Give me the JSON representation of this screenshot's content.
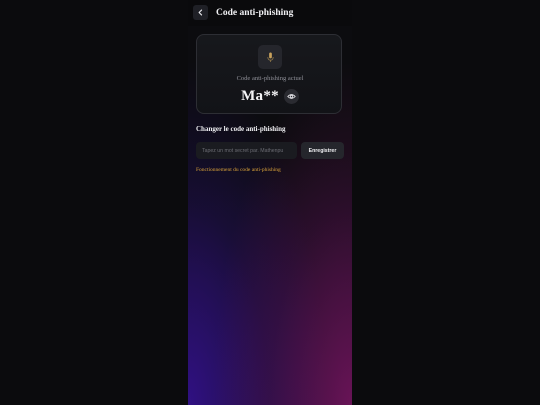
{
  "header": {
    "title": "Code anti-phishing",
    "back_icon": "chevron-left-icon"
  },
  "current_code": {
    "icon": "microphone-icon",
    "label": "Code anti-phishing actuel",
    "value": "Ma**",
    "reveal_icon": "eye-icon"
  },
  "change_section": {
    "title": "Changer le code anti-phishing",
    "input_placeholder": "Tapez un mot secret par. Mathenpu",
    "input_value": "",
    "save_label": "Enregistrer",
    "help_link": "Fonctionnement du code anti-phishing"
  },
  "colors": {
    "background": "#0b0b0d",
    "card": "#15161a",
    "link": "#d9a23a",
    "mic_accent": "#c9a25c",
    "glow_purple": "#3712a0",
    "glow_magenta": "#a8197a"
  }
}
